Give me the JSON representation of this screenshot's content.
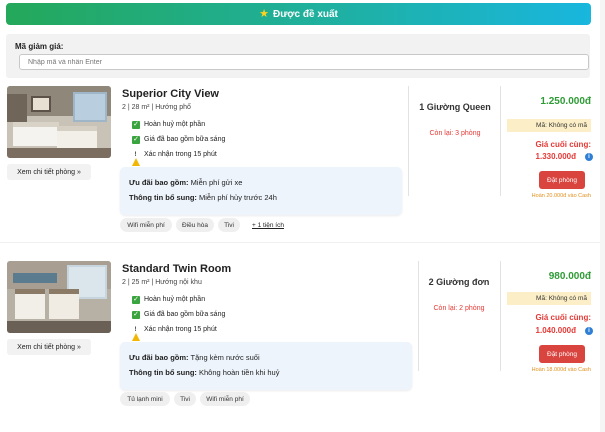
{
  "banner": {
    "title": "Được đề xuất",
    "icon": "star-icon"
  },
  "coupon": {
    "label": "Mã giảm giá:",
    "placeholder": "Nhập mã và nhấn Enter",
    "value": ""
  },
  "rooms": [
    {
      "name": "Superior City View",
      "meta": "2 | 28 m² | Hướng phố",
      "features": [
        "Hoàn huỷ một phần",
        "Giá đã bao gồm bữa sáng",
        "Xác nhận trong 15 phút"
      ],
      "detail_button": "Xem chi tiết phòng »",
      "offer_label": "Ưu đãi bao gồm:",
      "offer_value": "Miễn phí gửi xe",
      "extra_label": "Thông tin bổ sung:",
      "extra_value": "Miễn phí hủy trước 24h",
      "tags": [
        "Wifi miễn phí",
        "Điều hòa",
        "Tivi",
        "+ 1 tiện ích"
      ],
      "beds": "1 Giường Queen",
      "remaining": "Còn lại: 3 phòng",
      "price": "1.250.000đ",
      "code": "Mã: Không có mã",
      "final_label": "Giá cuối cùng:",
      "final_price": "1.330.000đ",
      "book_button": "Đặt phòng",
      "cashback": "Hoàn 20.000đ vào Cash"
    },
    {
      "name": "Standard Twin Room",
      "meta": "2 | 25 m² | Hướng nội khu",
      "features": [
        "Hoàn huỷ một phần",
        "Giá đã bao gồm bữa sáng",
        "Xác nhận trong 15 phút"
      ],
      "detail_button": "Xem chi tiết phòng »",
      "offer_label": "Ưu đãi bao gồm:",
      "offer_value": "Tặng kèm nước suối",
      "extra_label": "Thông tin bổ sung:",
      "extra_value": "Không hoàn tiền khi huỷ",
      "tags": [
        "Tủ lạnh mini",
        "Tivi",
        "Wifi miễn phí"
      ],
      "beds": "2 Giường đơn",
      "remaining": "Còn lại: 2 phòng",
      "price": "980.000đ",
      "code": "Mã: Không có mã",
      "final_label": "Giá cuối cùng:",
      "final_price": "1.040.000đ",
      "book_button": "Đặt phòng",
      "cashback": "Hoàn 18.000đ vào Cash"
    }
  ],
  "colors": {
    "banner_start": "#24a85a",
    "banner_end": "#19b6de",
    "price_green": "#2e9b36",
    "alert_red": "#e53935",
    "book_red": "#d9443f",
    "code_bg": "#fcefc7",
    "offer_bg": "#edf4fc",
    "cashback_orange": "#e0901d"
  }
}
